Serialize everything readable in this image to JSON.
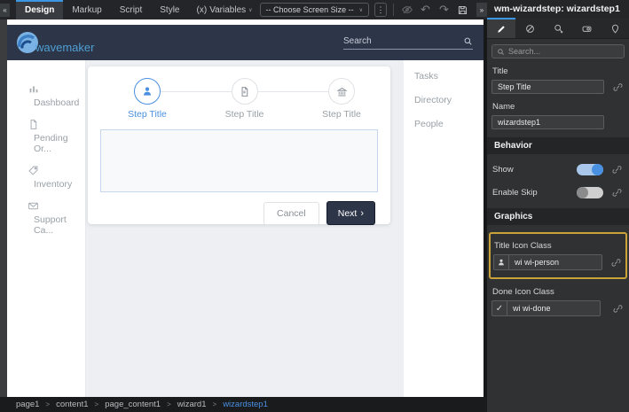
{
  "toolbar": {
    "collapse_icon": "«",
    "expand_icon": "»",
    "tabs": [
      {
        "label": "Design"
      },
      {
        "label": "Markup"
      },
      {
        "label": "Script"
      },
      {
        "label": "Style"
      }
    ],
    "variables_prefix": "(x)",
    "variables_label": "Variables",
    "chevron": "∨",
    "screen_size_dropdown": "-- Choose Screen Size --",
    "kebab_icon": "⋮",
    "undo_icon": "↶",
    "redo_icon": "↷"
  },
  "inspector": {
    "title": "wm-wizardstep: wizardstep1",
    "search_placeholder": "Search...",
    "tabs": [
      "properties",
      "styles",
      "advanced",
      "device",
      "marker"
    ],
    "fields": {
      "title": {
        "label": "Title",
        "value": "Step Title"
      },
      "name": {
        "label": "Name",
        "value": "wizardstep1"
      }
    },
    "sections": {
      "behavior": "Behavior",
      "graphics": "Graphics"
    },
    "toggles": {
      "show": {
        "label": "Show",
        "state": "on"
      },
      "enable_skip": {
        "label": "Enable Skip",
        "state": "off"
      }
    },
    "graphics": {
      "title_icon": {
        "label": "Title Icon Class",
        "value": "wi wi-person"
      },
      "done_icon": {
        "label": "Done Icon Class",
        "value": "wi wi-done",
        "check": "✓"
      }
    },
    "highlight_color": "#c9a23a",
    "accent_color": "#3b97e3"
  },
  "canvas": {
    "app_header": {
      "brand": "wavemaker",
      "search_label": "Search"
    },
    "sidebar": {
      "items": [
        {
          "icon": "bar-chart",
          "label": "Dashboard"
        },
        {
          "icon": "document",
          "label": "Pending Or..."
        },
        {
          "icon": "tag",
          "label": "Inventory"
        },
        {
          "icon": "mail",
          "label": "Support Ca..."
        }
      ]
    },
    "wizard": {
      "steps": [
        {
          "icon": "person",
          "label": "Step Title",
          "active": true
        },
        {
          "icon": "document",
          "label": "Step Title",
          "active": false
        },
        {
          "icon": "bank",
          "label": "Step Title",
          "active": false
        }
      ],
      "cancel_label": "Cancel",
      "next_label": "Next",
      "next_chevron": "›",
      "active_color": "#4a90e2"
    },
    "right_list": {
      "items": [
        "Tasks",
        "Directory",
        "People"
      ]
    }
  },
  "breadcrumb": {
    "separator": ">",
    "items": [
      "page1",
      "content1",
      "page_content1",
      "wizard1"
    ],
    "active": "wizardstep1"
  }
}
